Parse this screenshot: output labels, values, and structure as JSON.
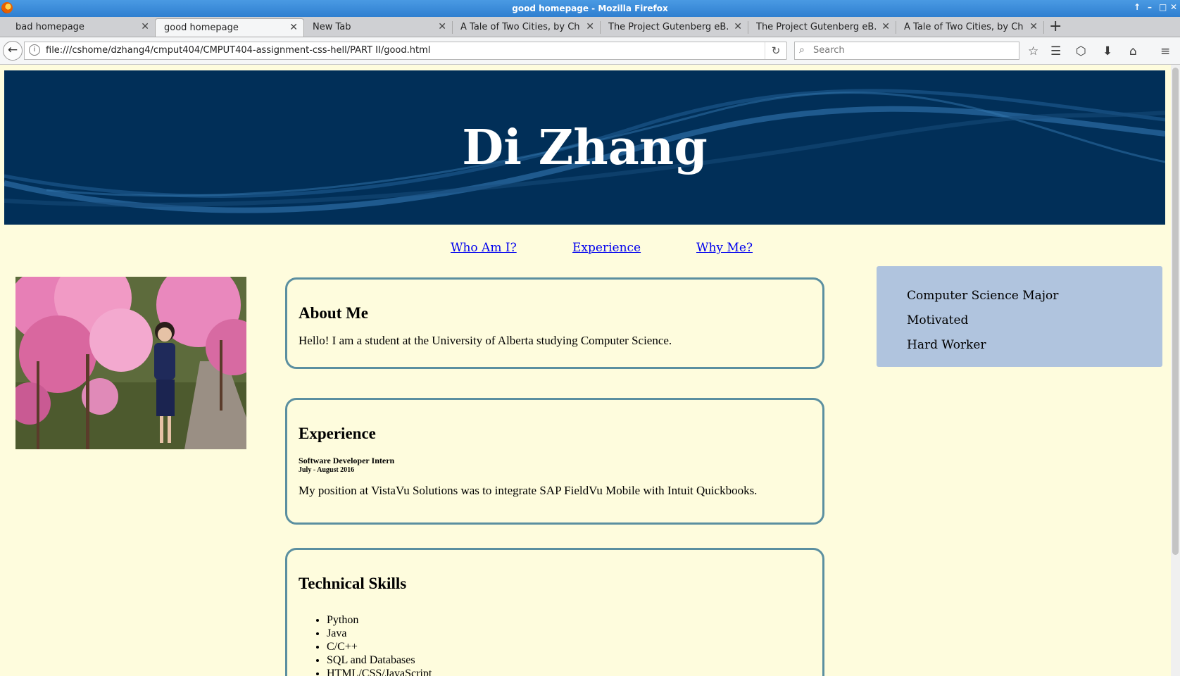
{
  "window": {
    "title": "good homepage - Mozilla Firefox"
  },
  "tabs": [
    {
      "label": "bad homepage",
      "active": false
    },
    {
      "label": "good homepage",
      "active": true
    },
    {
      "label": "New Tab",
      "active": false
    },
    {
      "label": "A Tale of Two Cities, by Ch...",
      "active": false
    },
    {
      "label": "The Project Gutenberg eB...",
      "active": false
    },
    {
      "label": "The Project Gutenberg eB...",
      "active": false
    },
    {
      "label": "A Tale of Two Cities, by Ch...",
      "active": false
    }
  ],
  "toolbar": {
    "url": "file:///cshome/dzhang4/cmput404/CMPUT404-assignment-css-hell/PART II/good.html",
    "search_placeholder": "Search",
    "icons": [
      "back-icon",
      "info-icon",
      "reload-icon",
      "search-icon",
      "bookmark-star-icon",
      "reading-list-icon",
      "pocket-icon",
      "download-icon",
      "home-icon",
      "menu-icon"
    ]
  },
  "page": {
    "name": "Di Zhang",
    "nav": [
      "Who Am I?",
      "Experience",
      "Why Me?"
    ],
    "about": {
      "heading": "About Me",
      "text": "Hello! I am a student at the University of Alberta studying Computer Science."
    },
    "experience": {
      "heading": "Experience",
      "job_title": "Software Developer Intern",
      "job_dates": "July - August 2016",
      "text": "My position at VistaVu Solutions was to integrate SAP FieldVu Mobile with Intuit Quickbooks."
    },
    "skills": {
      "heading": "Technical Skills",
      "items": [
        "Python",
        "Java",
        "C/C++",
        "SQL and Databases",
        "HTML/CSS/JavaScript"
      ]
    },
    "traits": [
      "Computer Science Major",
      "Motivated",
      "Hard Worker"
    ]
  },
  "colors": {
    "banner": "#012f58",
    "page_background": "#fefcdd",
    "card_border": "#5b8fa0",
    "sidebar_box": "#b0c4de",
    "link": "#0000ee"
  }
}
